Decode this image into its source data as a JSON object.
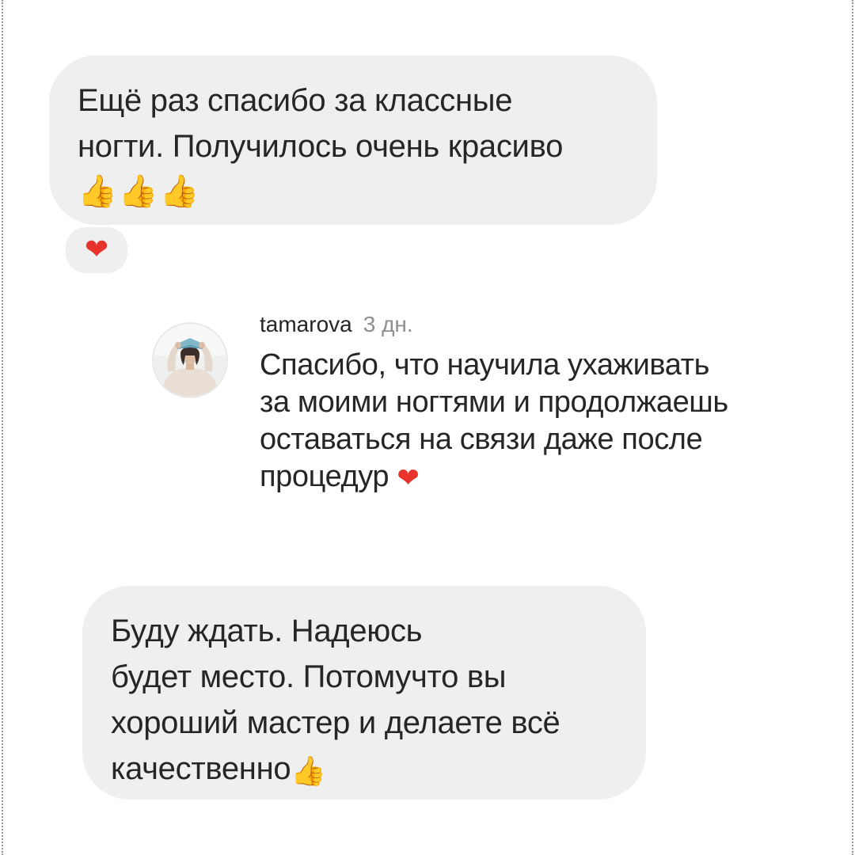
{
  "messages": [
    {
      "text": "Ещё раз спасибо за классные\nногти. Получилось очень красиво",
      "emoji_count": 3,
      "emoji_icon": "thumbs-up-icon",
      "emoji_glyph": "👍"
    },
    {
      "text": "Буду ждать. Надеюсь\nбудет  место. Потомучто вы\nхороший мастер и делаете всё\nкачественно",
      "emoji_icon": "thumbs-up-icon",
      "emoji_glyph": "👍"
    }
  ],
  "reaction": {
    "icon": "heart-icon",
    "glyph": "❤"
  },
  "reply": {
    "username": "tamarova",
    "time": "3 дн.",
    "text": "Спасибо, что научила ухаживать\nза моими ногтями и продолжаешь\nоставаться на связи даже после\nпроцедур ",
    "emoji_icon": "heart-icon",
    "emoji_glyph": "❤"
  },
  "colors": {
    "bubble": "#efefef",
    "text": "#262626",
    "meta": "#8e8e8e",
    "heart": "#e8332d",
    "thumbs": "#f7b21b"
  }
}
